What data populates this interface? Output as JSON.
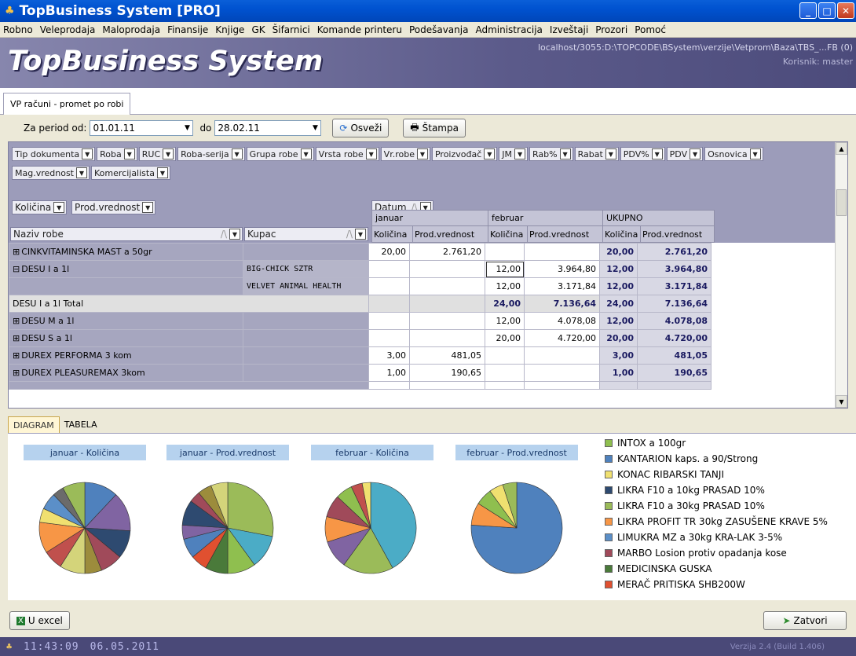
{
  "window": {
    "title": "TopBusiness System [PRO]"
  },
  "menu": [
    "Robno",
    "Veleprodaja",
    "Maloprodaja",
    "Finansije",
    "Knjige",
    "GK",
    "Šifarnici",
    "Komande printeru",
    "Podešavanja",
    "Administracija",
    "Izveštaji",
    "Prozori",
    "Pomoć"
  ],
  "banner": {
    "logo": "TopBusiness System",
    "path": "localhost/3055:D:\\TOPCODE\\BSystem\\verzije\\Vetprom\\Baza\\TBS_...FB (0)",
    "user": "Korisnik: master"
  },
  "tab": {
    "label": "VP računi - promet po robi"
  },
  "toolbar": {
    "from_label": "Za period od:",
    "from_value": "01.01.11",
    "to_label": "do",
    "to_value": "28.02.11",
    "refresh": "Osveži",
    "print": "Štampa"
  },
  "fields": [
    "Tip dokumenta",
    "Roba",
    "RUC",
    "Roba-serija",
    "Grupa robe",
    "Vrsta robe",
    "Vr.robe",
    "Proizvođač",
    "JM",
    "Rab%",
    "Rabat",
    "PDV%",
    "PDV",
    "Osnovica",
    "Mag.vrednost",
    "Komercijalista"
  ],
  "data_fields": [
    "Količina",
    "Prod.vrednost"
  ],
  "column_field": "Datum",
  "row_fields": [
    "Naziv robe",
    "Kupac"
  ],
  "months": [
    "januar",
    "februar",
    "UKUPNO"
  ],
  "sub_headers": [
    "Količina",
    "Prod.vrednost",
    "Količina",
    "Prod.vrednost",
    "Količina",
    "Prod.vrednost"
  ],
  "rows": [
    {
      "name": "CINKVITAMINSKA MAST a 50gr",
      "kupac": "",
      "v": [
        "20,00",
        "2.761,20",
        "",
        "",
        "20,00",
        "2.761,20"
      ]
    },
    {
      "name": "DESU I a 1l",
      "kupac": "BIG-CHICK SZTR",
      "v": [
        "",
        "",
        "12,00",
        "3.964,80",
        "12,00",
        "3.964,80"
      ]
    },
    {
      "name": "",
      "kupac": "VELVET ANIMAL HEALTH",
      "v": [
        "",
        "",
        "12,00",
        "3.171,84",
        "12,00",
        "3.171,84"
      ]
    },
    {
      "name": "DESU I a 1l Total",
      "kupac": "",
      "v": [
        "",
        "",
        "24,00",
        "7.136,64",
        "24,00",
        "7.136,64"
      ]
    },
    {
      "name": "DESU M a 1l",
      "kupac": "",
      "v": [
        "",
        "",
        "12,00",
        "4.078,08",
        "12,00",
        "4.078,08"
      ]
    },
    {
      "name": "DESU S a 1l",
      "kupac": "",
      "v": [
        "",
        "",
        "20,00",
        "4.720,00",
        "20,00",
        "4.720,00"
      ]
    },
    {
      "name": "DUREX PERFORMA 3 kom",
      "kupac": "",
      "v": [
        "3,00",
        "481,05",
        "",
        "",
        "3,00",
        "481,05"
      ]
    },
    {
      "name": "DUREX PLEASUREMAX 3kom",
      "kupac": "",
      "v": [
        "1,00",
        "190,65",
        "",
        "",
        "1,00",
        "190,65"
      ]
    }
  ],
  "bottom_tabs": [
    "DIAGRAM",
    "TABELA"
  ],
  "pie_titles": [
    "januar - Količina",
    "januar - Prod.vrednost",
    "februar - Količina",
    "februar - Prod.vrednost"
  ],
  "legend": [
    {
      "label": "INTOX a 100gr",
      "color": "#8fbf4f"
    },
    {
      "label": "KANTARION kaps. a 90/Strong",
      "color": "#4f81bd"
    },
    {
      "label": "KONAC RIBARSKI TANJI",
      "color": "#f0e070"
    },
    {
      "label": "LIKRA F10 a 10kg PRASAD 10%",
      "color": "#2e4a70"
    },
    {
      "label": "LIKRA F10 a 30kg PRASAD 10%",
      "color": "#9bbb59"
    },
    {
      "label": "LIKRA PROFIT TR 30kg ZASUŠENE KRAVE 5%",
      "color": "#f79646"
    },
    {
      "label": "LIMUKRA MZ a 30kg KRA-LAK 3-5%",
      "color": "#5b8fc8"
    },
    {
      "label": "MARBO Losion protiv opadanja kose",
      "color": "#a04a5a"
    },
    {
      "label": "MEDICINSKA GUSKA",
      "color": "#4a7a3a"
    },
    {
      "label": "MERAČ PRITISKA SHB200W",
      "color": "#e05030"
    }
  ],
  "buttons": {
    "excel": "U excel",
    "close": "Zatvori"
  },
  "status": {
    "time": "11:43:09",
    "date": "06.05.2011",
    "version": "Verzija 2.4 (Build 1.406)"
  }
}
